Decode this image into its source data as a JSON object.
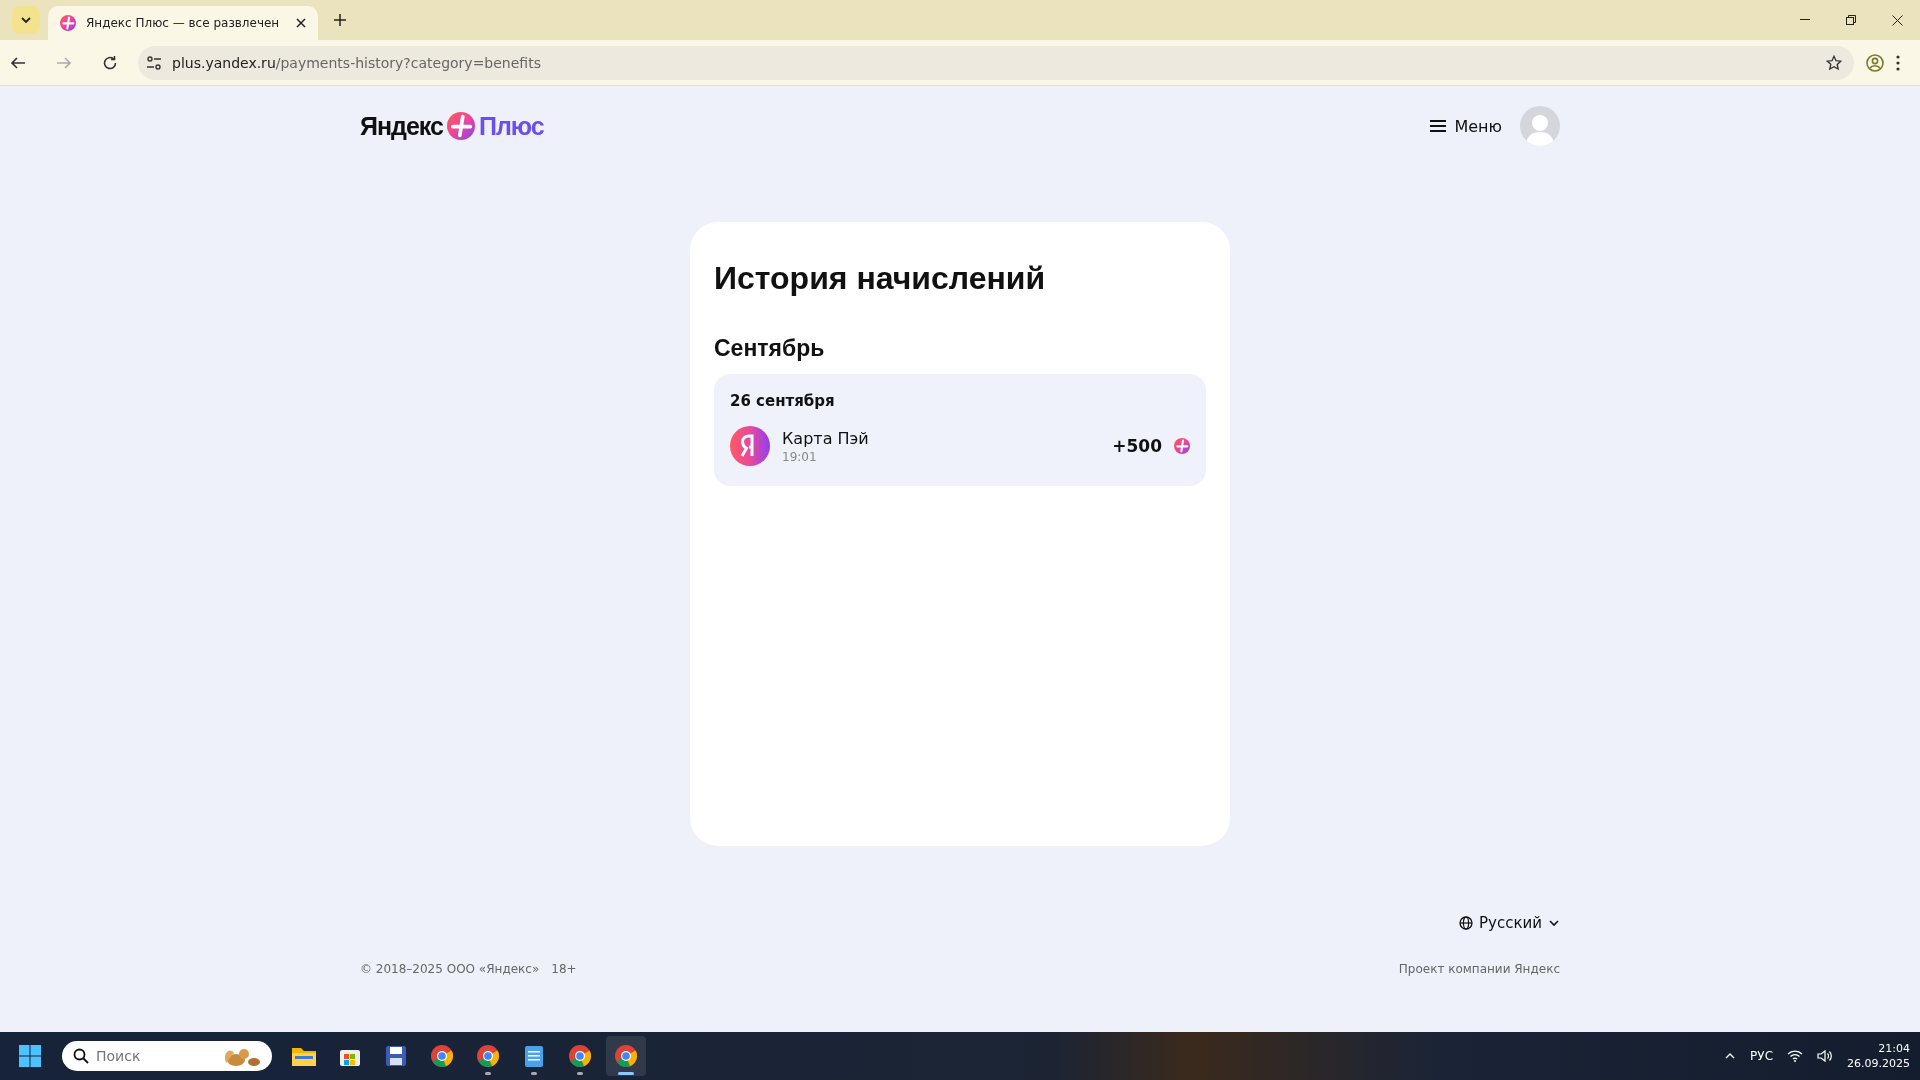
{
  "browser": {
    "tabs": [
      {
        "title": "Яндекс Плюс — все развлечен",
        "selected": true
      }
    ],
    "url_host": "plus.yandex.ru",
    "url_path": "/payments-history?category=benefits"
  },
  "header": {
    "logo_word": "Яндекс",
    "logo_product": "Плюс",
    "menu_label": "Меню"
  },
  "history": {
    "title": "История начислений",
    "months": [
      {
        "name": "Сентябрь",
        "days": [
          {
            "date": "26 сентября",
            "entries": [
              {
                "name": "Карта Пэй",
                "time": "19:01",
                "amount": "+500"
              }
            ]
          }
        ]
      }
    ]
  },
  "footer": {
    "language": "Русский",
    "copyright": "© 2018–2025 ООО «Яндекс»",
    "age": "18+",
    "project": "Проект компании Яндекс"
  },
  "taskbar": {
    "search_placeholder": "Поиск",
    "apps": [
      {
        "kind": "folder",
        "running": false,
        "selected": false
      },
      {
        "kind": "store",
        "running": false,
        "selected": false
      },
      {
        "kind": "floppy",
        "running": false,
        "selected": false
      },
      {
        "kind": "chrome",
        "running": false,
        "selected": false
      },
      {
        "kind": "chrome",
        "running": true,
        "selected": false
      },
      {
        "kind": "notepad",
        "running": true,
        "selected": false
      },
      {
        "kind": "chrome",
        "running": true,
        "selected": false
      },
      {
        "kind": "chrome",
        "running": true,
        "selected": true
      }
    ],
    "language": "РУС",
    "time": "21:04",
    "date": "26.09.2025"
  }
}
